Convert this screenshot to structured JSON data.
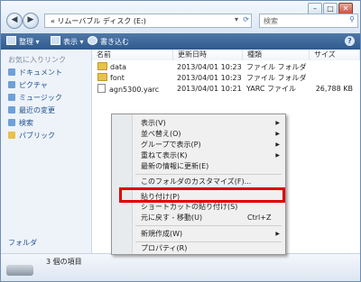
{
  "titlebar": {
    "minimize": "–",
    "maximize": "□",
    "close": "✕"
  },
  "address": {
    "path": "« リムーバブル ディスク (E:)",
    "chevron": "▾",
    "refresh": "⟳"
  },
  "search": {
    "placeholder": "検索",
    "icon": "⚲"
  },
  "toolbar": {
    "organize": "整理",
    "view": "表示",
    "burn": "書き込む",
    "help": "?"
  },
  "sidebar": {
    "heading": "お気に入りリンク",
    "items": [
      {
        "label": "ドキュメント",
        "icon": "document-icon"
      },
      {
        "label": "ピクチャ",
        "icon": "picture-icon"
      },
      {
        "label": "ミュージック",
        "icon": "music-icon"
      },
      {
        "label": "最近の変更",
        "icon": "recent-icon"
      },
      {
        "label": "検索",
        "icon": "search-icon"
      },
      {
        "label": "パブリック",
        "icon": "public-icon"
      }
    ],
    "folders": "フォルダ"
  },
  "columns": [
    "名前",
    "更新日時",
    "種類",
    "サイズ"
  ],
  "files": [
    {
      "name": "data",
      "date": "2013/04/01 10:23",
      "type": "ファイル フォルダ",
      "size": "",
      "kind": "folder"
    },
    {
      "name": "font",
      "date": "2013/04/01 10:23",
      "type": "ファイル フォルダ",
      "size": "",
      "kind": "folder"
    },
    {
      "name": "agn5300.yarc",
      "date": "2013/04/01 10:21",
      "type": "YARC ファイル",
      "size": "26,788 KB",
      "kind": "file"
    }
  ],
  "status": {
    "count": "3 個の項目"
  },
  "context_menu": {
    "items": [
      {
        "label": "表示(V)",
        "submenu": true
      },
      {
        "label": "並べ替え(O)",
        "submenu": true
      },
      {
        "label": "グループで表示(P)",
        "submenu": true
      },
      {
        "label": "重ねて表示(K)",
        "submenu": true
      },
      {
        "label": "最新の情報に更新(E)"
      },
      {
        "label": "このフォルダのカスタマイズ(F)..."
      },
      {
        "label": "貼り付け(P)"
      },
      {
        "label": "ショートカットの貼り付け(S)"
      },
      {
        "label": "元に戻す - 移動(U)",
        "shortcut": "Ctrl+Z"
      },
      {
        "label": "新規作成(W)",
        "submenu": true
      },
      {
        "label": "プロパティ(R)"
      }
    ],
    "arrow": "▶"
  },
  "colors": {
    "highlight_border": "#e00000",
    "toolbar": "#2f5a8e"
  }
}
